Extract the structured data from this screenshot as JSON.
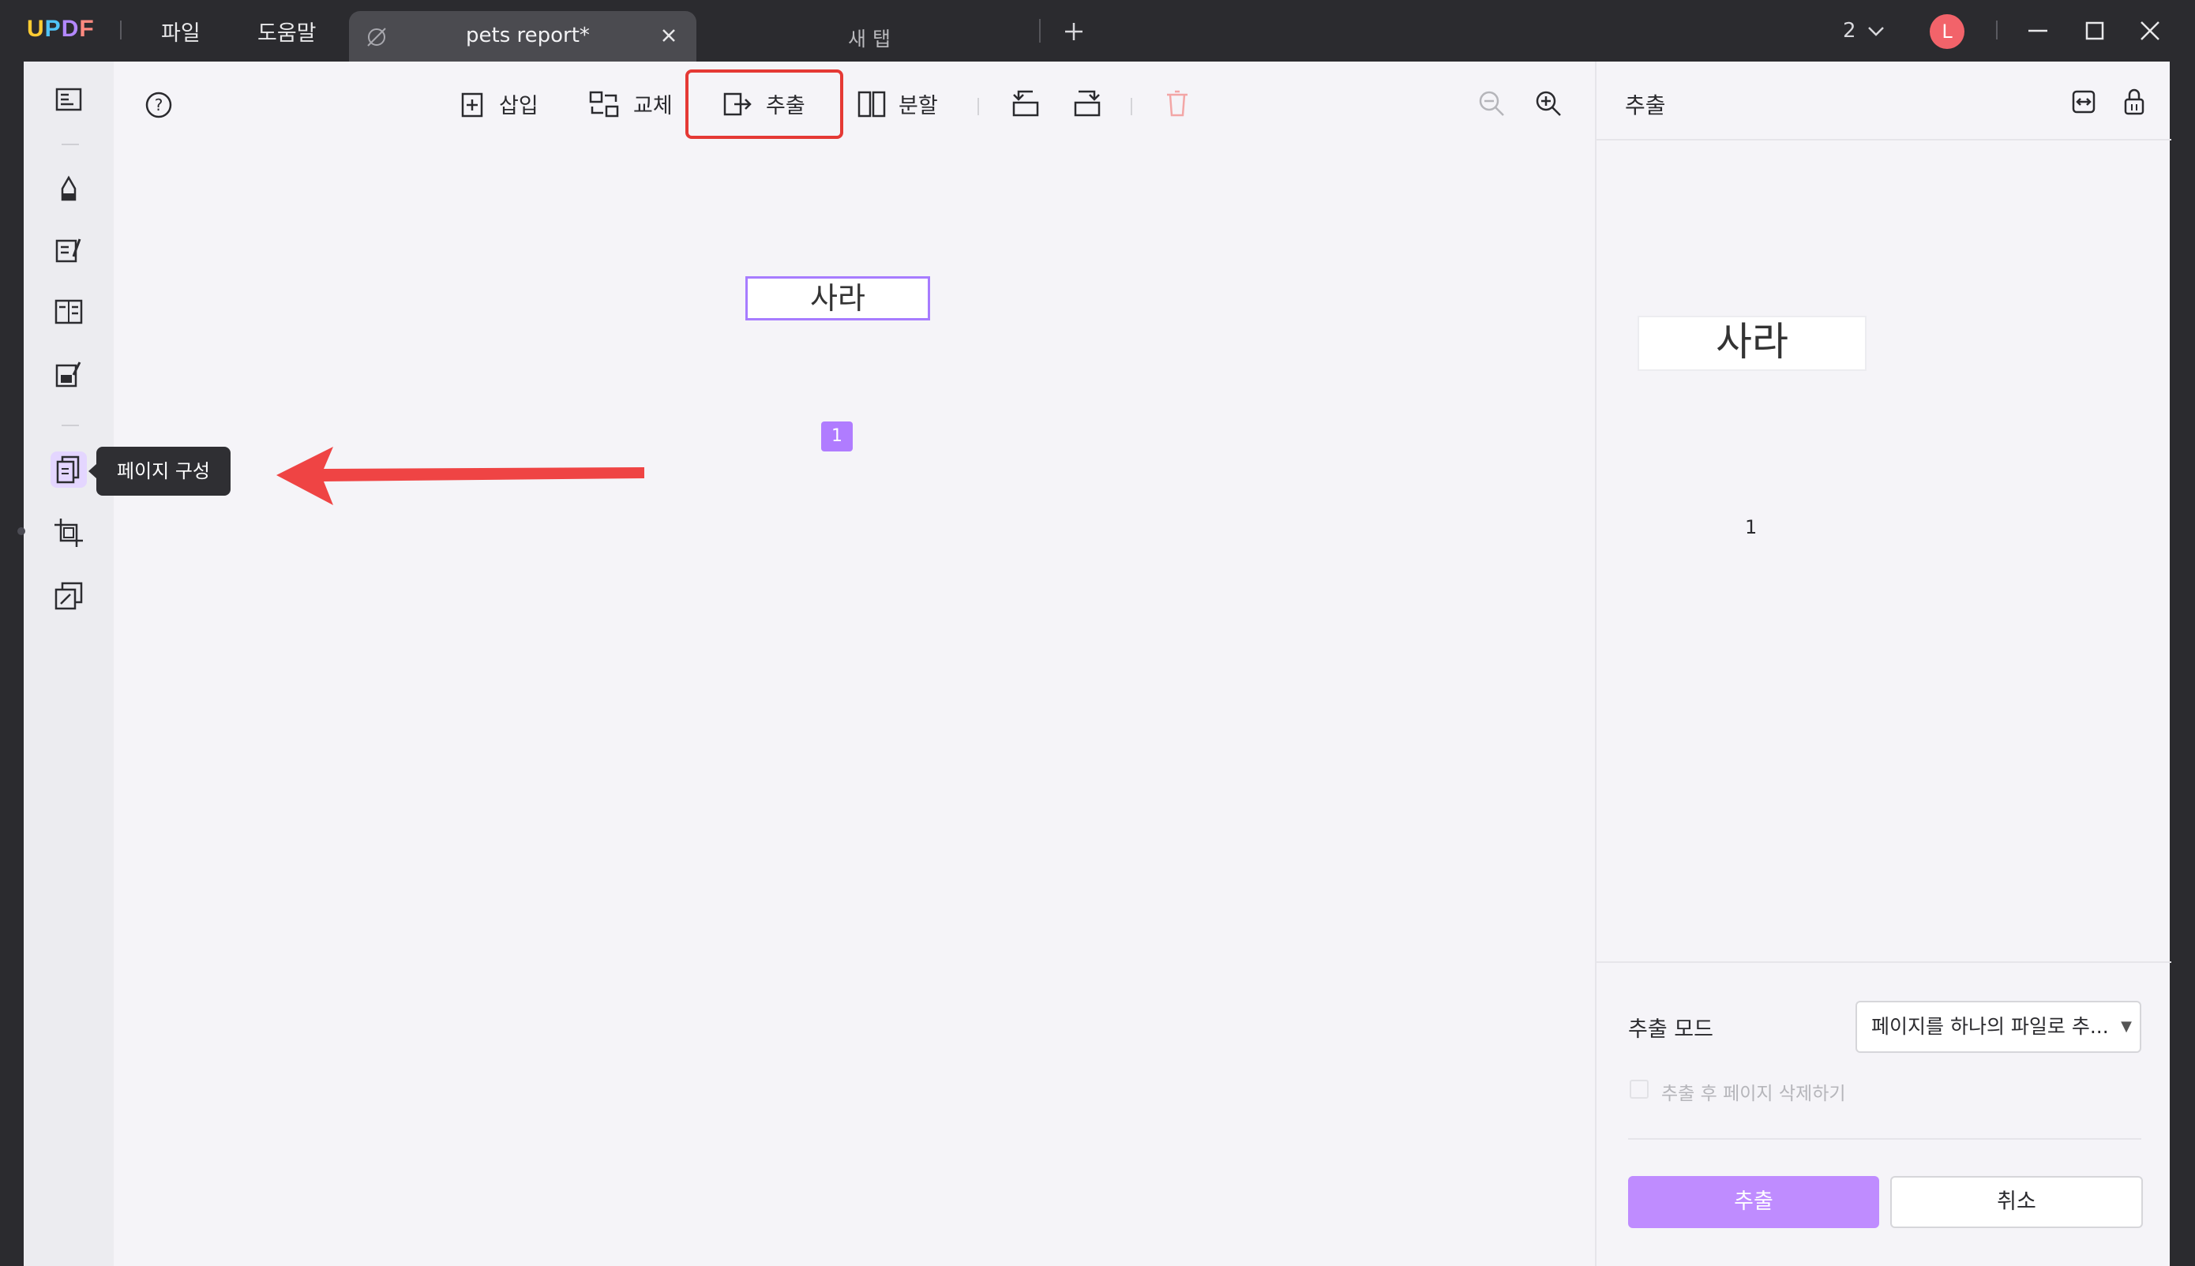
{
  "app": {
    "logo": "UPDF",
    "menu": [
      "파일",
      "도움말"
    ],
    "tabs": {
      "active_title": "pets report*",
      "inactive_title": "새 탭"
    },
    "window_count": "2",
    "avatar_letter": "L"
  },
  "toolbar": {
    "insert_label": "삽입",
    "replace_label": "교체",
    "extract_label": "추출",
    "split_label": "분할"
  },
  "sidebar": {
    "tooltip": "페이지 구성",
    "icons": [
      "reader-icon",
      "comment-icon",
      "edit-icon",
      "form-icon",
      "ocr-icon",
      "organize-pages-icon",
      "crop-icon",
      "tools-icon"
    ]
  },
  "document": {
    "page_badge": "1",
    "handwriting": "사라"
  },
  "extract_panel": {
    "title": "추출",
    "thumb_label": "1",
    "mode_label": "추출 모드",
    "mode_value": "페이지를 하나의 파일로 추...",
    "delete_after_label": "추출 후 페이지 삭제하기",
    "extract_button": "추출",
    "cancel_button": "취소"
  },
  "colors": {
    "accent": "#bf8cff",
    "highlight": "#e53935",
    "arrow": "#ef4444",
    "avatar": "#f2636a"
  }
}
